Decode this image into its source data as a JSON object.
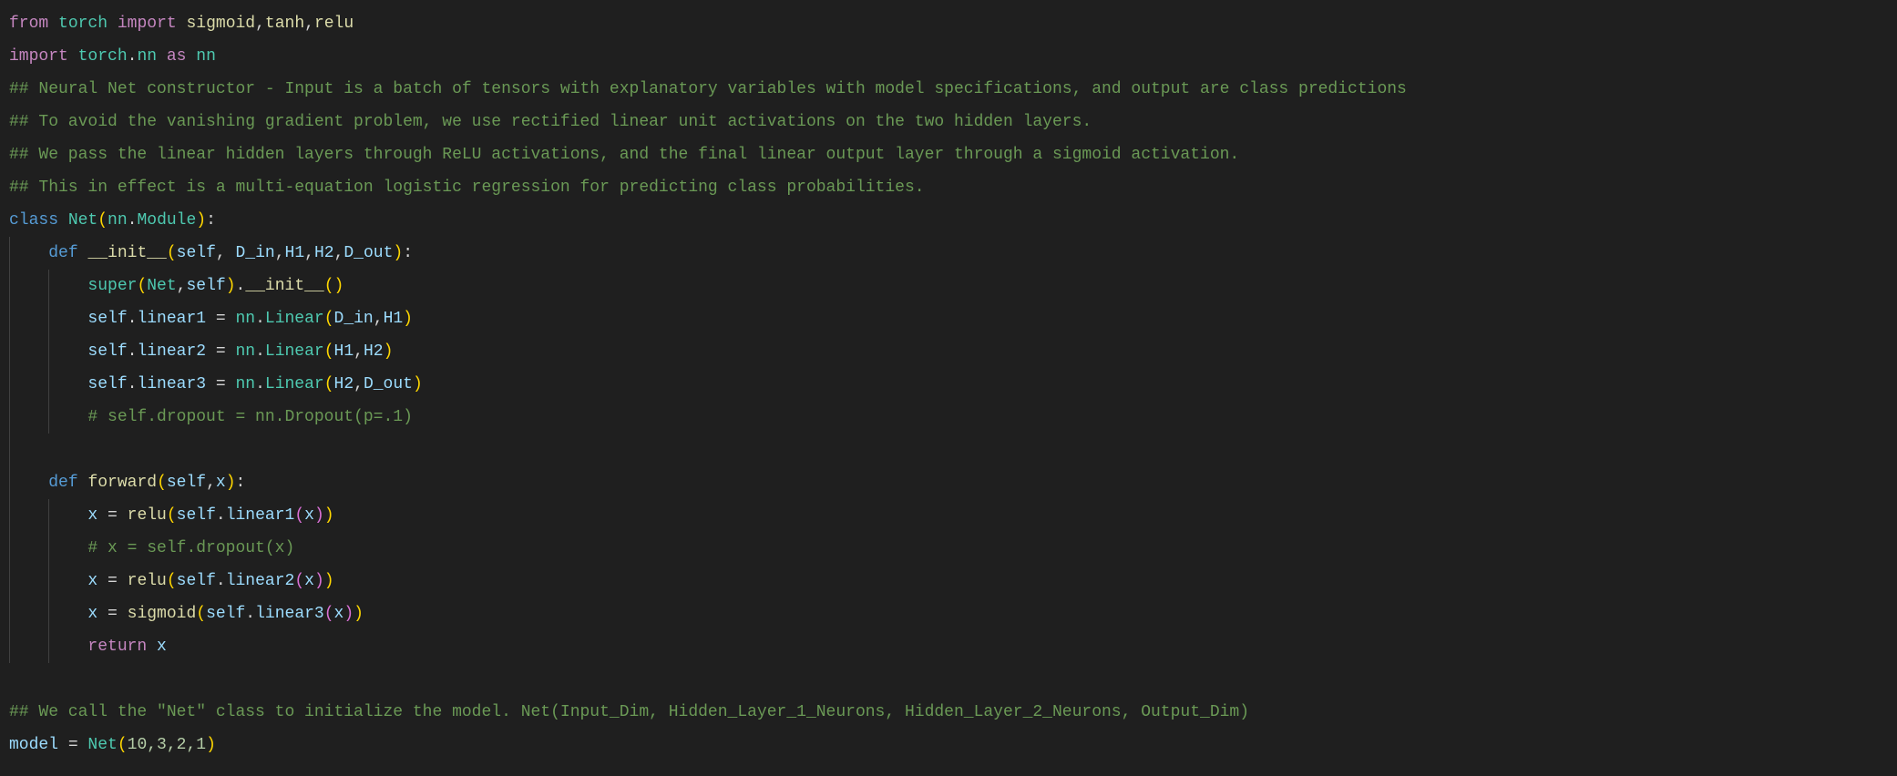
{
  "colors": {
    "background": "#1f1f1f",
    "keyword": "#c586c0",
    "module": "#4ec9b0",
    "function": "#dcdcaa",
    "comment": "#6a9955",
    "variable": "#9cdcfe",
    "storage": "#569cd6",
    "bracket1": "#ffd700",
    "bracket2": "#da70d6"
  },
  "lines": [
    {
      "tokens": [
        {
          "t": "from",
          "c": "kw"
        },
        {
          "t": " "
        },
        {
          "t": "torch",
          "c": "mod"
        },
        {
          "t": " "
        },
        {
          "t": "import",
          "c": "kw"
        },
        {
          "t": " "
        },
        {
          "t": "sigmoid",
          "c": "fn"
        },
        {
          "t": ","
        },
        {
          "t": "tanh",
          "c": "fn"
        },
        {
          "t": ","
        },
        {
          "t": "relu",
          "c": "fn"
        }
      ]
    },
    {
      "tokens": [
        {
          "t": "import",
          "c": "kw"
        },
        {
          "t": " "
        },
        {
          "t": "torch",
          "c": "mod"
        },
        {
          "t": "."
        },
        {
          "t": "nn",
          "c": "mod"
        },
        {
          "t": " "
        },
        {
          "t": "as",
          "c": "kw"
        },
        {
          "t": " "
        },
        {
          "t": "nn",
          "c": "mod"
        }
      ]
    },
    {
      "tokens": [
        {
          "t": "## Neural Net constructor - Input is a batch of tensors with explanatory variables with model specifications, and output are class predictions",
          "c": "cm"
        }
      ]
    },
    {
      "tokens": [
        {
          "t": "## To avoid the vanishing gradient problem, we use rectified linear unit activations on the two hidden layers.",
          "c": "cm"
        }
      ]
    },
    {
      "tokens": [
        {
          "t": "## We pass the linear hidden layers through ReLU activations, and the final linear output layer through a sigmoid activation.",
          "c": "cm"
        }
      ]
    },
    {
      "tokens": [
        {
          "t": "## This in effect is a multi-equation logistic regression for predicting class probabilities.",
          "c": "cm"
        }
      ]
    },
    {
      "tokens": [
        {
          "t": "class",
          "c": "st"
        },
        {
          "t": " "
        },
        {
          "t": "Net",
          "c": "mod"
        },
        {
          "t": "(",
          "c": "b1"
        },
        {
          "t": "nn",
          "c": "mod"
        },
        {
          "t": "."
        },
        {
          "t": "Module",
          "c": "mod"
        },
        {
          "t": ")",
          "c": "b1"
        },
        {
          "t": ":"
        }
      ]
    },
    {
      "tokens": [
        {
          "t": "    "
        },
        {
          "t": "def",
          "c": "st"
        },
        {
          "t": " "
        },
        {
          "t": "__init__",
          "c": "fn"
        },
        {
          "t": "(",
          "c": "b1"
        },
        {
          "t": "self",
          "c": "var"
        },
        {
          "t": ", "
        },
        {
          "t": "D_in",
          "c": "var"
        },
        {
          "t": ","
        },
        {
          "t": "H1",
          "c": "var"
        },
        {
          "t": ","
        },
        {
          "t": "H2",
          "c": "var"
        },
        {
          "t": ","
        },
        {
          "t": "D_out",
          "c": "var"
        },
        {
          "t": ")",
          "c": "b1"
        },
        {
          "t": ":"
        }
      ]
    },
    {
      "tokens": [
        {
          "t": "        "
        },
        {
          "t": "super",
          "c": "mod"
        },
        {
          "t": "(",
          "c": "b1"
        },
        {
          "t": "Net",
          "c": "mod"
        },
        {
          "t": ","
        },
        {
          "t": "self",
          "c": "var"
        },
        {
          "t": ")",
          "c": "b1"
        },
        {
          "t": "."
        },
        {
          "t": "__init__",
          "c": "fn"
        },
        {
          "t": "()",
          "c": "b1"
        }
      ]
    },
    {
      "tokens": [
        {
          "t": "        "
        },
        {
          "t": "self",
          "c": "var"
        },
        {
          "t": "."
        },
        {
          "t": "linear1",
          "c": "var"
        },
        {
          "t": " = "
        },
        {
          "t": "nn",
          "c": "mod"
        },
        {
          "t": "."
        },
        {
          "t": "Linear",
          "c": "mod"
        },
        {
          "t": "(",
          "c": "b1"
        },
        {
          "t": "D_in",
          "c": "var"
        },
        {
          "t": ","
        },
        {
          "t": "H1",
          "c": "var"
        },
        {
          "t": ")",
          "c": "b1"
        }
      ]
    },
    {
      "tokens": [
        {
          "t": "        "
        },
        {
          "t": "self",
          "c": "var"
        },
        {
          "t": "."
        },
        {
          "t": "linear2",
          "c": "var"
        },
        {
          "t": " = "
        },
        {
          "t": "nn",
          "c": "mod"
        },
        {
          "t": "."
        },
        {
          "t": "Linear",
          "c": "mod"
        },
        {
          "t": "(",
          "c": "b1"
        },
        {
          "t": "H1",
          "c": "var"
        },
        {
          "t": ","
        },
        {
          "t": "H2",
          "c": "var"
        },
        {
          "t": ")",
          "c": "b1"
        }
      ]
    },
    {
      "tokens": [
        {
          "t": "        "
        },
        {
          "t": "self",
          "c": "var"
        },
        {
          "t": "."
        },
        {
          "t": "linear3",
          "c": "var"
        },
        {
          "t": " = "
        },
        {
          "t": "nn",
          "c": "mod"
        },
        {
          "t": "."
        },
        {
          "t": "Linear",
          "c": "mod"
        },
        {
          "t": "(",
          "c": "b1"
        },
        {
          "t": "H2",
          "c": "var"
        },
        {
          "t": ","
        },
        {
          "t": "D_out",
          "c": "var"
        },
        {
          "t": ")",
          "c": "b1"
        }
      ]
    },
    {
      "tokens": [
        {
          "t": "        "
        },
        {
          "t": "# self.dropout = nn.Dropout(p=.1)",
          "c": "cm"
        }
      ]
    },
    {
      "tokens": []
    },
    {
      "tokens": [
        {
          "t": "    "
        },
        {
          "t": "def",
          "c": "st"
        },
        {
          "t": " "
        },
        {
          "t": "forward",
          "c": "fn"
        },
        {
          "t": "(",
          "c": "b1"
        },
        {
          "t": "self",
          "c": "var"
        },
        {
          "t": ","
        },
        {
          "t": "x",
          "c": "var"
        },
        {
          "t": ")",
          "c": "b1"
        },
        {
          "t": ":"
        }
      ]
    },
    {
      "tokens": [
        {
          "t": "        "
        },
        {
          "t": "x",
          "c": "var"
        },
        {
          "t": " = "
        },
        {
          "t": "relu",
          "c": "fn"
        },
        {
          "t": "(",
          "c": "b1"
        },
        {
          "t": "self",
          "c": "var"
        },
        {
          "t": "."
        },
        {
          "t": "linear1",
          "c": "var"
        },
        {
          "t": "(",
          "c": "b2"
        },
        {
          "t": "x",
          "c": "var"
        },
        {
          "t": ")",
          "c": "b2"
        },
        {
          "t": ")",
          "c": "b1"
        }
      ]
    },
    {
      "tokens": [
        {
          "t": "        "
        },
        {
          "t": "# x = self.dropout(x)",
          "c": "cm"
        }
      ]
    },
    {
      "tokens": [
        {
          "t": "        "
        },
        {
          "t": "x",
          "c": "var"
        },
        {
          "t": " = "
        },
        {
          "t": "relu",
          "c": "fn"
        },
        {
          "t": "(",
          "c": "b1"
        },
        {
          "t": "self",
          "c": "var"
        },
        {
          "t": "."
        },
        {
          "t": "linear2",
          "c": "var"
        },
        {
          "t": "(",
          "c": "b2"
        },
        {
          "t": "x",
          "c": "var"
        },
        {
          "t": ")",
          "c": "b2"
        },
        {
          "t": ")",
          "c": "b1"
        }
      ]
    },
    {
      "tokens": [
        {
          "t": "        "
        },
        {
          "t": "x",
          "c": "var"
        },
        {
          "t": " = "
        },
        {
          "t": "sigmoid",
          "c": "fn"
        },
        {
          "t": "(",
          "c": "b1"
        },
        {
          "t": "self",
          "c": "var"
        },
        {
          "t": "."
        },
        {
          "t": "linear3",
          "c": "var"
        },
        {
          "t": "(",
          "c": "b2"
        },
        {
          "t": "x",
          "c": "var"
        },
        {
          "t": ")",
          "c": "b2"
        },
        {
          "t": ")",
          "c": "b1"
        }
      ]
    },
    {
      "tokens": [
        {
          "t": "        "
        },
        {
          "t": "return",
          "c": "kw"
        },
        {
          "t": " "
        },
        {
          "t": "x",
          "c": "var"
        }
      ]
    },
    {
      "tokens": []
    },
    {
      "tokens": [
        {
          "t": "## We call the \"Net\" class to initialize the model. Net(Input_Dim, Hidden_Layer_1_Neurons, Hidden_Layer_2_Neurons, Output_Dim)",
          "c": "cm"
        }
      ]
    },
    {
      "tokens": [
        {
          "t": "model",
          "c": "var"
        },
        {
          "t": " = "
        },
        {
          "t": "Net",
          "c": "mod"
        },
        {
          "t": "(",
          "c": "b1"
        },
        {
          "t": "10,3,2,1",
          "c": "num"
        },
        {
          "t": ")",
          "c": "b1"
        }
      ]
    }
  ]
}
